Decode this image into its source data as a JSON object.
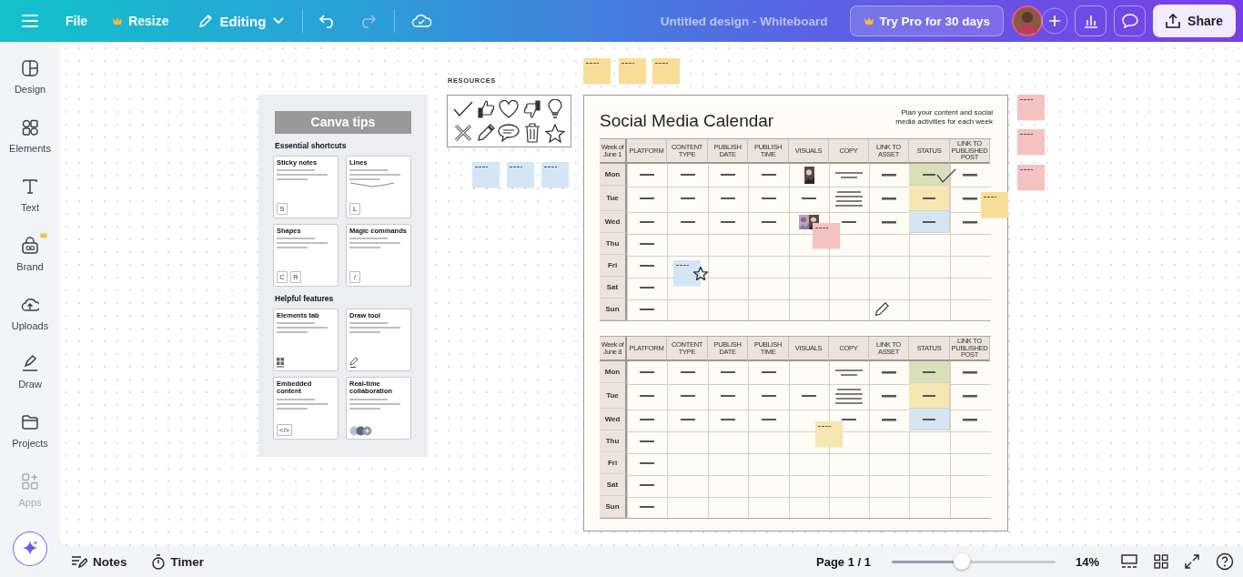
{
  "topbar": {
    "file": "File",
    "resize": "Resize",
    "mode": "Editing",
    "title": "Untitled design - Whiteboard",
    "pro_button": "Try Pro for 30 days",
    "share": "Share"
  },
  "sidebar": [
    {
      "label": "Design",
      "kind": "design",
      "premium": false,
      "disabled": false
    },
    {
      "label": "Elements",
      "kind": "elements",
      "premium": false,
      "disabled": false
    },
    {
      "label": "Text",
      "kind": "text",
      "premium": false,
      "disabled": false
    },
    {
      "label": "Brand",
      "kind": "brand",
      "premium": true,
      "disabled": false
    },
    {
      "label": "Uploads",
      "kind": "uploads",
      "premium": false,
      "disabled": false
    },
    {
      "label": "Draw",
      "kind": "draw",
      "premium": false,
      "disabled": false
    },
    {
      "label": "Projects",
      "kind": "projects",
      "premium": false,
      "disabled": false
    },
    {
      "label": "Apps",
      "kind": "apps",
      "premium": false,
      "disabled": true
    }
  ],
  "tips": {
    "title": "Canva tips",
    "sections": [
      {
        "heading": "Essential shortcuts",
        "cards": [
          {
            "title": "Sticky notes",
            "footer": {
              "kind": "keys",
              "keys": [
                "S"
              ]
            }
          },
          {
            "title": "Lines",
            "footer": {
              "kind": "keys",
              "keys": [
                "L"
              ]
            }
          },
          {
            "title": "Shapes",
            "footer": {
              "kind": "keys",
              "keys": [
                "C",
                "R"
              ]
            }
          },
          {
            "title": "Magic commands",
            "footer": {
              "kind": "keys",
              "keys": [
                "/"
              ]
            }
          }
        ]
      },
      {
        "heading": "Helpful features",
        "cards": [
          {
            "title": "Elements tab",
            "footer": {
              "kind": "elements"
            }
          },
          {
            "title": "Draw tool",
            "footer": {
              "kind": "draw"
            }
          },
          {
            "title": "Embedded content",
            "footer": {
              "kind": "keys",
              "keys": [
                "</>"
              ]
            }
          },
          {
            "title": "Real-time collaboration",
            "footer": {
              "kind": "avatars"
            }
          }
        ]
      }
    ]
  },
  "resources": {
    "title": "RESOURCES"
  },
  "calendar": {
    "title": "Social Media Calendar",
    "subtitle": "Plan your content and social media activities for each week",
    "weeks": [
      {
        "columns": [
          "Week of June 1",
          "PLATFORM",
          "CONTENT TYPE",
          "PUBLISH DATE",
          "PUBLISH TIME",
          "VISUALS",
          "COPY",
          "LINK TO ASSET",
          "STATUS",
          "LINK TO PUBLISHED POST"
        ],
        "rows": [
          {
            "day": "Mon",
            "cells": [
              {
                "kind": "text"
              },
              {
                "kind": "text"
              },
              {
                "kind": "text"
              },
              {
                "kind": "text"
              },
              {
                "kind": "picture"
              },
              {
                "kind": "paragraph"
              },
              {
                "kind": "link"
              },
              {
                "kind": "status",
                "color": "#d9e0b8"
              },
              {
                "kind": "link"
              }
            ]
          },
          {
            "day": "Tue",
            "cells": [
              {
                "kind": "text"
              },
              {
                "kind": "text"
              },
              {
                "kind": "text"
              },
              {
                "kind": "text"
              },
              {
                "kind": "text"
              },
              {
                "kind": "paragraph"
              },
              {
                "kind": "link"
              },
              {
                "kind": "status",
                "color": "#f6e6b2"
              },
              {
                "kind": "link"
              }
            ]
          },
          {
            "day": "Wed",
            "cells": [
              {
                "kind": "text"
              },
              {
                "kind": "text"
              },
              {
                "kind": "text"
              },
              {
                "kind": "text"
              },
              {
                "kind": "picture_pair"
              },
              {
                "kind": "text"
              },
              {
                "kind": "link"
              },
              {
                "kind": "status",
                "color": "#d4e5f3"
              },
              {
                "kind": "link"
              }
            ]
          },
          {
            "day": "Thu",
            "cells": [
              {
                "kind": "text"
              }
            ]
          },
          {
            "day": "Fri",
            "cells": [
              {
                "kind": "text"
              }
            ]
          },
          {
            "day": "Sat",
            "cells": [
              {
                "kind": "text"
              }
            ]
          },
          {
            "day": "Sun",
            "cells": [
              {
                "kind": "text"
              }
            ]
          }
        ]
      },
      {
        "columns": [
          "Week of June 8",
          "PLATFORM",
          "CONTENT TYPE",
          "PUBLISH DATE",
          "PUBLISH TIME",
          "VISUALS",
          "COPY",
          "LINK TO ASSET",
          "STATUS",
          "LINK TO PUBLISHED POST"
        ],
        "rows": [
          {
            "day": "Mon",
            "cells": [
              {
                "kind": "text"
              },
              {
                "kind": "text"
              },
              {
                "kind": "text"
              },
              {
                "kind": "text"
              },
              {
                "kind": "empty"
              },
              {
                "kind": "paragraph"
              },
              {
                "kind": "link"
              },
              {
                "kind": "status",
                "color": "#d9e0b8"
              },
              {
                "kind": "link"
              }
            ]
          },
          {
            "day": "Tue",
            "cells": [
              {
                "kind": "text"
              },
              {
                "kind": "text"
              },
              {
                "kind": "text"
              },
              {
                "kind": "text"
              },
              {
                "kind": "text"
              },
              {
                "kind": "paragraph"
              },
              {
                "kind": "link"
              },
              {
                "kind": "status",
                "color": "#f6e6b2"
              },
              {
                "kind": "link"
              }
            ]
          },
          {
            "day": "Wed",
            "cells": [
              {
                "kind": "text"
              },
              {
                "kind": "text"
              },
              {
                "kind": "text"
              },
              {
                "kind": "text"
              },
              {
                "kind": "empty"
              },
              {
                "kind": "text"
              },
              {
                "kind": "link"
              },
              {
                "kind": "status",
                "color": "#d4e5f3"
              },
              {
                "kind": "link"
              }
            ]
          },
          {
            "day": "Thu",
            "cells": [
              {
                "kind": "text"
              }
            ]
          },
          {
            "day": "Fri",
            "cells": [
              {
                "kind": "text"
              }
            ]
          },
          {
            "day": "Sat",
            "cells": [
              {
                "kind": "text"
              }
            ]
          },
          {
            "day": "Sun",
            "cells": [
              {
                "kind": "text"
              }
            ]
          }
        ]
      }
    ]
  },
  "sticky_notes": [
    {
      "color": "#f8dd96"
    },
    {
      "color": "#f8dd96"
    },
    {
      "color": "#f8dd96"
    },
    {
      "color": "#f5c1c1"
    },
    {
      "color": "#f5c1c1"
    },
    {
      "color": "#f5c1c1"
    },
    {
      "color": "#d3e6f6"
    },
    {
      "color": "#d3e6f6"
    },
    {
      "color": "#d3e6f6"
    },
    {
      "color": "#f8dd96"
    },
    {
      "color": "#f5c1c1"
    },
    {
      "color": "#d3e6f6"
    },
    {
      "color": "#f6e6b2"
    }
  ],
  "bottombar": {
    "notes": "Notes",
    "timer": "Timer",
    "page": "Page 1 / 1",
    "zoom": {
      "level": 0.43,
      "reading": "14%"
    }
  }
}
